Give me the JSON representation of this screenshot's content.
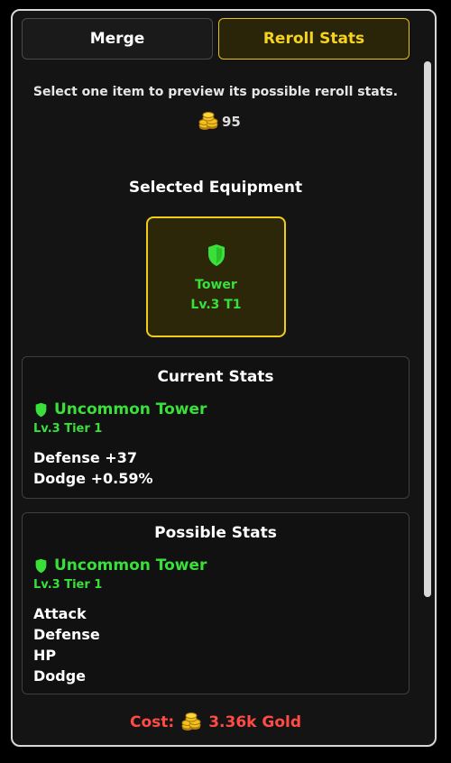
{
  "tabs": {
    "merge": "Merge",
    "reroll": "Reroll Stats"
  },
  "instruction": "Select one item to preview its possible reroll stats.",
  "gold": {
    "amount": "95",
    "icon": "gold-coins-icon"
  },
  "selected": {
    "title": "Selected Equipment",
    "item_name": "Tower",
    "item_level": "Lv.3 T1",
    "icon": "shield-icon"
  },
  "current": {
    "title": "Current Stats",
    "item_name": "Uncommon Tower",
    "item_level": "Lv.3 Tier 1",
    "stats": [
      "Defense +37",
      "Dodge +0.59%"
    ]
  },
  "possible": {
    "title": "Possible Stats",
    "item_name": "Uncommon Tower",
    "item_level": "Lv.3 Tier 1",
    "stats": [
      "Attack",
      "Defense",
      "HP",
      "Dodge"
    ]
  },
  "cost": {
    "label": "Cost:",
    "value": "3.36k Gold"
  },
  "colors": {
    "uncommon": "#39e03a",
    "accent_gold": "#f0cd16",
    "cost_red": "#ff4b44"
  }
}
